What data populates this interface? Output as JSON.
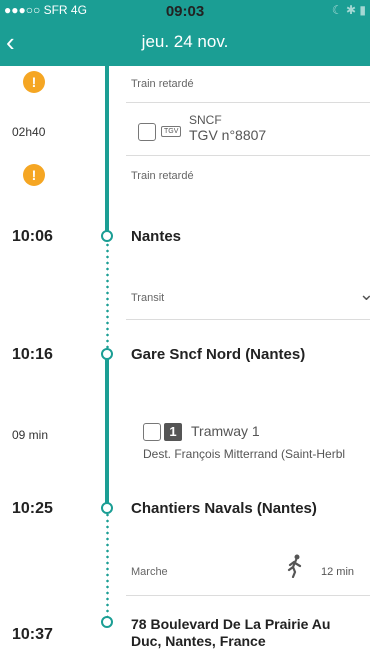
{
  "status": {
    "carrier": "●●●○○ SFR  4G",
    "time": "09:03",
    "right": "☾ ✱ ▮"
  },
  "header": {
    "back_icon": "‹",
    "title": "jeu. 24 nov."
  },
  "segments": {
    "delay1": "Train retardé",
    "train_duration": "02h40",
    "train_operator": "SNCF",
    "train_line": "TGV n°8807",
    "tgv_badge": "TGV",
    "delay2": "Train retardé",
    "transit": "Transit",
    "tram_duration": "09 min",
    "tram_number": "1",
    "tram_line": "Tramway 1",
    "tram_dest": "Dest. François Mitterrand (Saint-Herbl",
    "walk_label": "Marche",
    "walk_duration": "12 min"
  },
  "stops": [
    {
      "time": "10:06",
      "name": "Nantes"
    },
    {
      "time": "10:16",
      "name": "Gare Sncf Nord (Nantes)"
    },
    {
      "time": "10:25",
      "name": "Chantiers Navals (Nantes)"
    },
    {
      "time": "10:37",
      "name_line1": "78 Boulevard De La Prairie Au",
      "name_line2": "Duc, Nantes, France"
    }
  ],
  "colors": {
    "accent": "#1b9e94",
    "warning": "#f5a623"
  }
}
